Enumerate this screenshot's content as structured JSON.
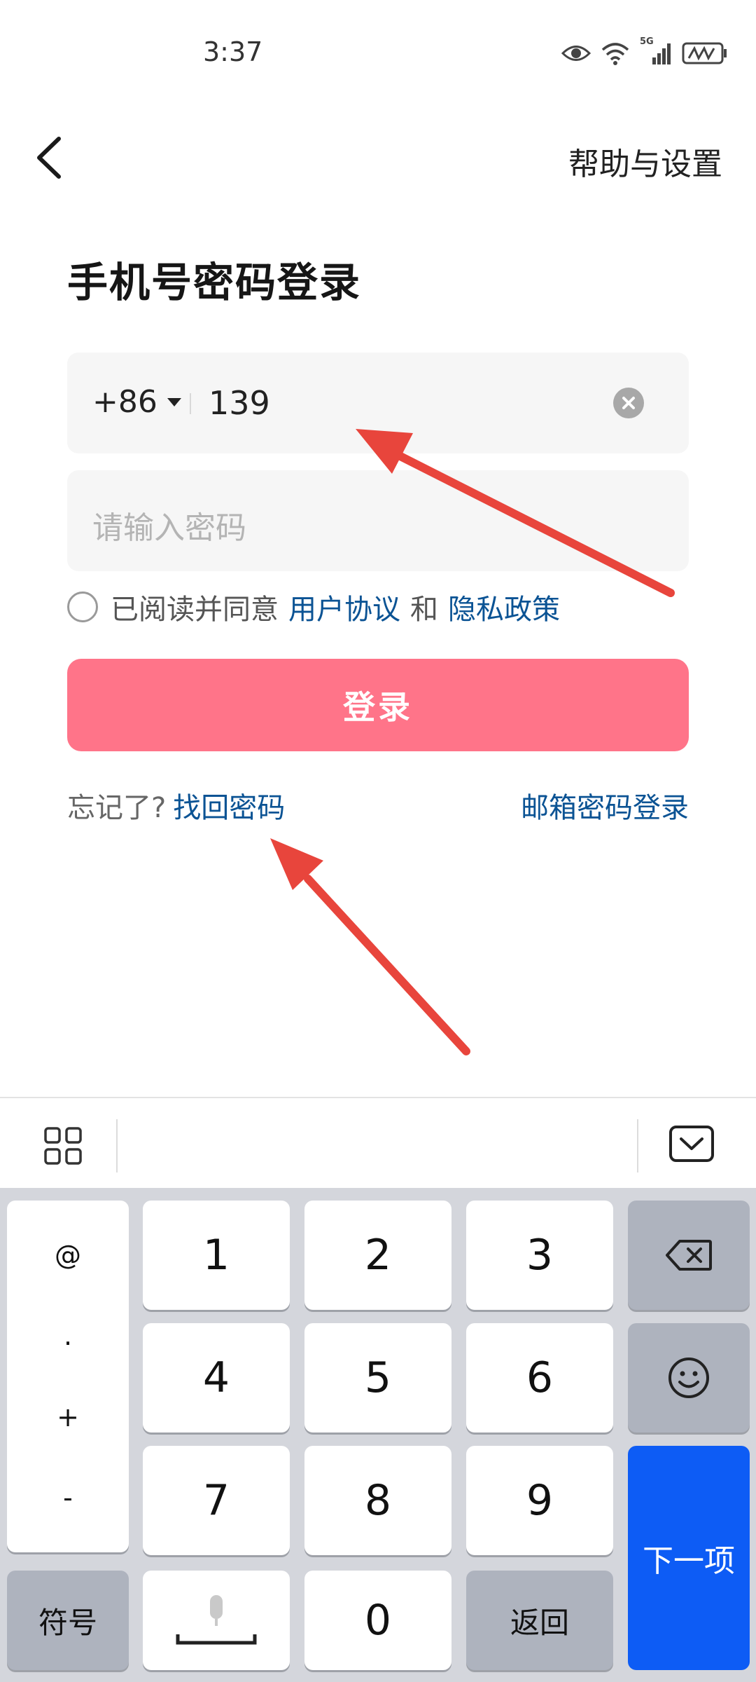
{
  "status_bar": {
    "time": "3:37",
    "network_label": "5G"
  },
  "header": {
    "help_label": "帮助与设置"
  },
  "page": {
    "title": "手机号密码登录"
  },
  "phone_input": {
    "country_code": "+86",
    "value": "139"
  },
  "password_input": {
    "placeholder": "请输入密码"
  },
  "agreement": {
    "prefix": "已阅读并同意",
    "user_agreement": "用户协议",
    "and": "和",
    "privacy_policy": "隐私政策"
  },
  "login_button": {
    "label": "登录"
  },
  "links": {
    "forgot_label": "忘记了?",
    "recover_password": "找回密码",
    "email_login": "邮箱密码登录"
  },
  "keyboard": {
    "symbols": [
      "@",
      ".",
      "+",
      "-"
    ],
    "digits": [
      "1",
      "2",
      "3",
      "4",
      "5",
      "6",
      "7",
      "8",
      "9",
      "0"
    ],
    "symbol_key": "符号",
    "return_key": "返回",
    "next_key": "下一项"
  },
  "colors": {
    "accent": "#ff7489",
    "link": "#0b5394",
    "next_key": "#0d5cf5",
    "annotation_arrow": "#e8453c"
  },
  "icons": [
    "back-arrow-icon",
    "eye-icon",
    "wifi-icon",
    "signal-icon",
    "battery-icon",
    "clear-icon",
    "grid-icon",
    "collapse-keyboard-icon",
    "backspace-icon",
    "emoji-icon",
    "microphone-icon"
  ]
}
